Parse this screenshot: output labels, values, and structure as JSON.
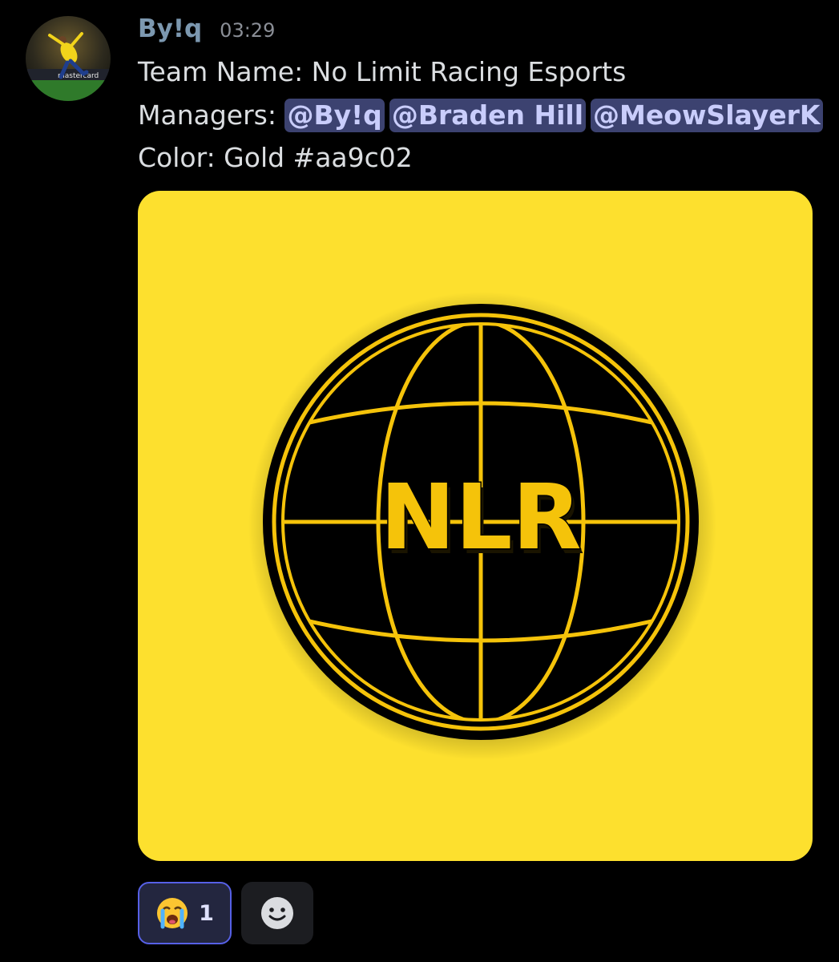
{
  "message": {
    "author": "By!q",
    "timestamp": "03:29",
    "lines": {
      "team_label": "Team Name: No Limit Racing Esports",
      "managers_label": "Managers:",
      "color_label": "Color: Gold #aa9c02"
    },
    "mentions": [
      "@By!q",
      "@Braden Hill",
      "@MeowSlayerK"
    ],
    "avatar": {
      "icon": "soccer-player-avatar",
      "text": "mastercard"
    },
    "attachment": {
      "icon": "nlr-globe-logo",
      "logo_text": "NLR",
      "background_color": "#fde02e",
      "logo_color": "#f5c30a"
    },
    "reactions": [
      {
        "emoji": "loudly-crying-face-icon",
        "count": "1"
      }
    ],
    "add_reaction_icon": "smiley-face-icon"
  },
  "colors": {
    "background": "#000000",
    "username": "#7c98b0",
    "mention_bg": "#3c4270",
    "mention_text": "#c9cdfb",
    "reaction_border": "#5660e6"
  }
}
